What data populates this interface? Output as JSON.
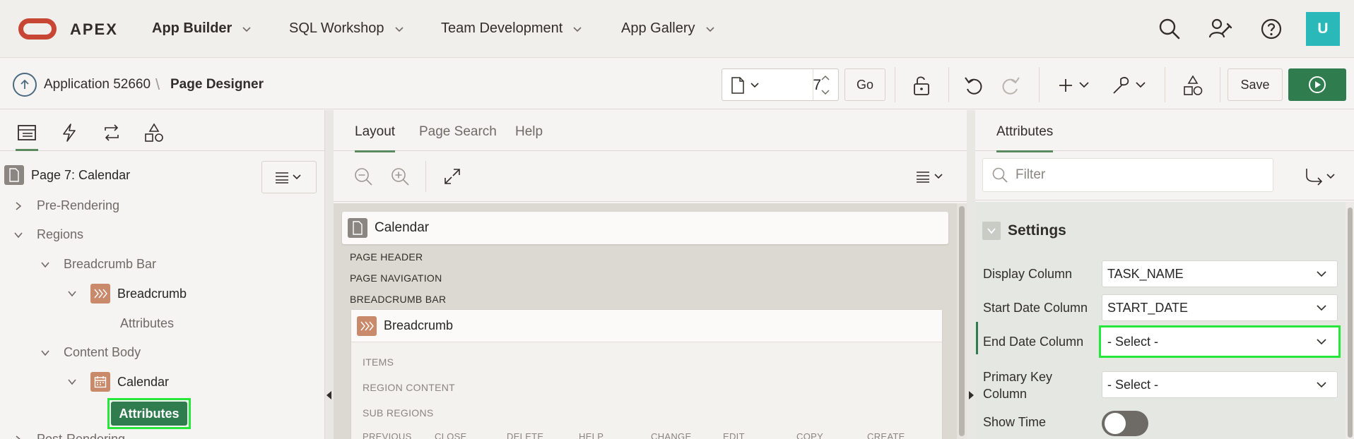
{
  "header": {
    "brand": "APEX",
    "nav": [
      {
        "label": "App Builder"
      },
      {
        "label": "SQL Workshop"
      },
      {
        "label": "Team Development"
      },
      {
        "label": "App Gallery"
      }
    ],
    "user_initial": "U"
  },
  "toolbar": {
    "breadcrumb_app": "Application 52660",
    "breadcrumb_sep": "\\",
    "breadcrumb_page": "Page Designer",
    "page_number": "7",
    "go_label": "Go",
    "save_label": "Save"
  },
  "left_panel": {
    "root_label": "Page 7: Calendar",
    "tree": [
      {
        "label": "Pre-Rendering"
      },
      {
        "label": "Regions"
      },
      {
        "label": "Breadcrumb Bar"
      },
      {
        "label": "Breadcrumb"
      },
      {
        "label": "Attributes"
      },
      {
        "label": "Content Body"
      },
      {
        "label": "Calendar"
      },
      {
        "label": "Attributes"
      },
      {
        "label": "Post-Rendering"
      }
    ]
  },
  "center": {
    "tabs": [
      {
        "label": "Layout"
      },
      {
        "label": "Page Search"
      },
      {
        "label": "Help"
      }
    ],
    "page_title": "Calendar",
    "slots": [
      "PAGE HEADER",
      "PAGE NAVIGATION",
      "BREADCRUMB BAR"
    ],
    "breadcrumb_region": "Breadcrumb",
    "region_slots": [
      "ITEMS",
      "REGION CONTENT",
      "SUB REGIONS"
    ],
    "button_slots": [
      "PREVIOUS",
      "CLOSE",
      "DELETE",
      "HELP",
      "CHANGE",
      "EDIT",
      "COPY",
      "CREATE"
    ]
  },
  "right_panel": {
    "tab": "Attributes",
    "filter_placeholder": "Filter",
    "section": "Settings",
    "props": [
      {
        "label": "Display Column",
        "value": "TASK_NAME"
      },
      {
        "label": "Start Date Column",
        "value": "START_DATE"
      },
      {
        "label": "End Date Column",
        "value": "- Select -"
      },
      {
        "label": "Primary Key Column",
        "value": "- Select -"
      },
      {
        "label": "Show Time",
        "value": ""
      }
    ],
    "show_time": false
  },
  "colors": {
    "oracle_red": "#c74634",
    "primary_green": "#2f7d4f",
    "highlight": "#26e83a",
    "avatar_teal": "#2bb8b8",
    "region_icon": "#c98a6b"
  }
}
